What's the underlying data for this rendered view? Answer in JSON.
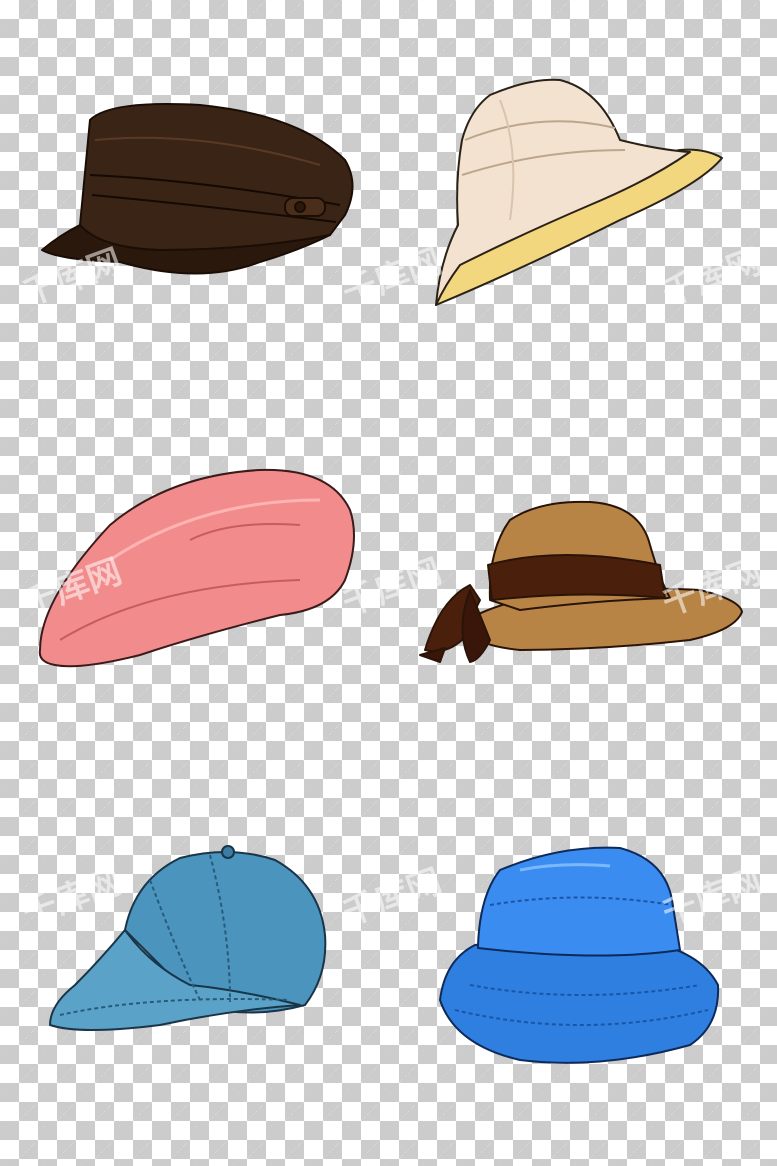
{
  "image": {
    "background": "transparency-checkerboard",
    "checker_light": "#ffffff",
    "checker_dark": "#cccccc"
  },
  "hats": [
    {
      "name": "newsboy-cap",
      "color": "#3a2416"
    },
    {
      "name": "wide-brim-sun-hat",
      "color": "#f3e2cf",
      "inner_color": "#f2d77f"
    },
    {
      "name": "beret",
      "color": "#f28c8c"
    },
    {
      "name": "cloche-hat-with-bow",
      "color": "#b88446",
      "band_color": "#4a1f0c"
    },
    {
      "name": "baseball-cap",
      "color": "#4a94bd"
    },
    {
      "name": "bucket-hat",
      "color": "#2e7fe0"
    }
  ],
  "watermark": {
    "text": "千库网"
  }
}
